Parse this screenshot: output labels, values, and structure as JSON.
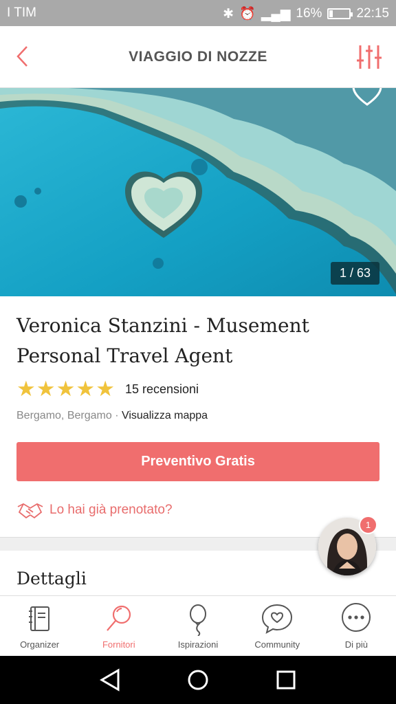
{
  "status_bar": {
    "carrier": "I TIM",
    "battery": "16%",
    "time": "22:15"
  },
  "header": {
    "title": "VIAGGIO DI NOZZE",
    "back_icon": "chevron-left-icon",
    "filter_icon": "sliders-icon"
  },
  "gallery": {
    "counter": "1 / 63"
  },
  "vendor": {
    "name": "Veronica Stanzini - Musement Personal Travel Agent",
    "rating": 5,
    "reviews": "15 recensioni",
    "location": "Bergamo, Bergamo",
    "separator": "·",
    "map_link": "Visualizza mappa"
  },
  "actions": {
    "quote_button": "Preventivo Gratis",
    "booked_link": "Lo hai già prenotato?"
  },
  "details": {
    "heading": "Dettagli"
  },
  "chat": {
    "badge": "1"
  },
  "bottom_nav": {
    "items": [
      {
        "label": "Organizer",
        "icon": "planner-icon"
      },
      {
        "label": "Fornitori",
        "icon": "search-icon"
      },
      {
        "label": "Ispirazioni",
        "icon": "balloon-icon"
      },
      {
        "label": "Community",
        "icon": "chat-heart-icon"
      },
      {
        "label": "Di più",
        "icon": "more-icon"
      }
    ],
    "active_index": 1
  },
  "colors": {
    "accent": "#f06e6e",
    "star": "#f0c33c"
  }
}
